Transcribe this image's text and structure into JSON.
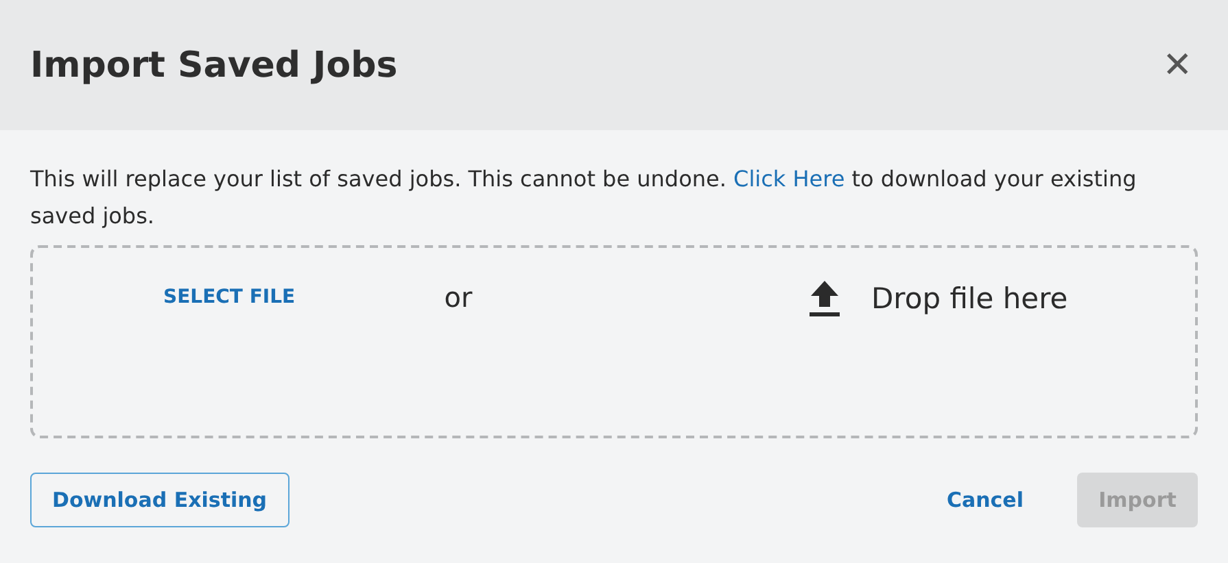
{
  "dialog": {
    "title": "Import Saved Jobs",
    "close_label": "✕"
  },
  "message": {
    "before": "This will replace your list of saved jobs. This cannot be undone. ",
    "link": "Click Here",
    "after": " to download your existing saved jobs."
  },
  "dropzone": {
    "select_label": "SELECT FILE",
    "separator": "or",
    "drop_label": "Drop file here"
  },
  "buttons": [
    {
      "label": "Download Existing",
      "kind": "outlined",
      "disabled": false
    },
    {
      "label": "Cancel",
      "kind": "text",
      "disabled": false
    },
    {
      "label": "Import",
      "kind": "filled",
      "disabled": true
    }
  ]
}
